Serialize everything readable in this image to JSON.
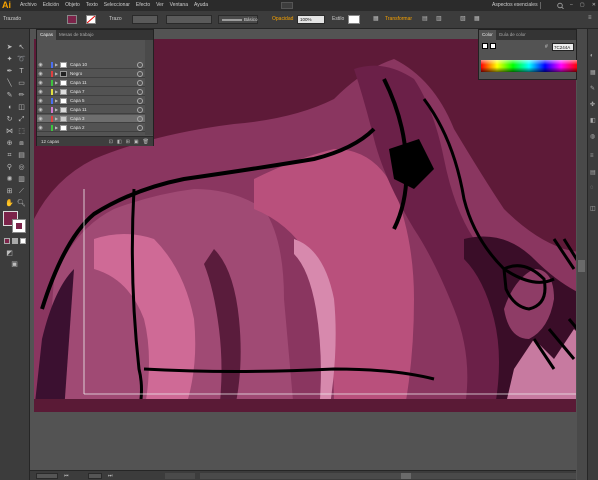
{
  "app": {
    "logo": "Ai",
    "menu": [
      "Archivo",
      "Edición",
      "Objeto",
      "Texto",
      "Seleccionar",
      "Efecto",
      "Ver",
      "Ventana",
      "Ayuda"
    ],
    "workspace": "Aspectos esenciales"
  },
  "controlbar": {
    "tool_label": "Trazado",
    "stroke_label": "Trazo",
    "brush_label": "Básico",
    "opacity_label": "Opacidad",
    "opacity_value": "100%",
    "style_label": "Estilo",
    "transform_label": "Transformar"
  },
  "document": {
    "tab_title": "Stefanie Bild.ai* al 100% (RGB/Previsualizar)"
  },
  "layers_panel": {
    "tabs": [
      "Capas",
      "Mesas de trabajo"
    ],
    "rows": [
      {
        "name": "Capa 10",
        "color": "#4b6ff0"
      },
      {
        "name": "Negro",
        "color": "#e04040"
      },
      {
        "name": "Capa 11",
        "color": "#3ec43e"
      },
      {
        "name": "Capa 7",
        "color": "#e0e040"
      },
      {
        "name": "Capa 5",
        "color": "#4b6ff0"
      },
      {
        "name": "Capa 11",
        "color": "#d07ad0"
      },
      {
        "name": "Capa 3",
        "color": "#e04040"
      },
      {
        "name": "Capa 2",
        "color": "#3ec43e"
      }
    ],
    "count": "12 capas"
  },
  "color_panel": {
    "tabs": [
      "Color",
      "Guía de color"
    ],
    "hex": "7C244A"
  },
  "colors": {
    "fill": "#7c244a",
    "art_bg": "#5a1834"
  }
}
